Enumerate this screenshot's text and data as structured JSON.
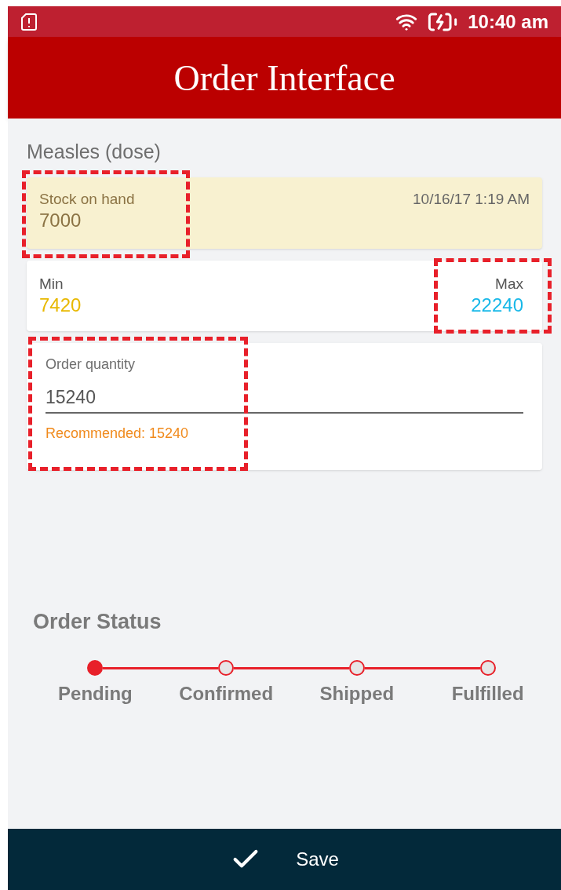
{
  "status_bar": {
    "time": "10:40 am"
  },
  "header": {
    "title": "Order Interface"
  },
  "product": {
    "name": "Measles (dose)"
  },
  "stock_on_hand": {
    "label": "Stock on hand",
    "value": "7000",
    "timestamp": "10/16/17 1:19 AM",
    "highlighted": true
  },
  "min": {
    "label": "Min",
    "value": "7420"
  },
  "max": {
    "label": "Max",
    "value": "22240",
    "highlighted": true
  },
  "order_quantity": {
    "label": "Order quantity",
    "value": "15240",
    "recommendation": "Recommended: 15240",
    "highlighted": true
  },
  "order_status": {
    "title": "Order Status",
    "steps": [
      {
        "label": "Pending",
        "selected": true
      },
      {
        "label": "Confirmed",
        "selected": false
      },
      {
        "label": "Shipped",
        "selected": false
      },
      {
        "label": "Fulfilled",
        "selected": false
      }
    ]
  },
  "save_button": {
    "label": "Save"
  }
}
